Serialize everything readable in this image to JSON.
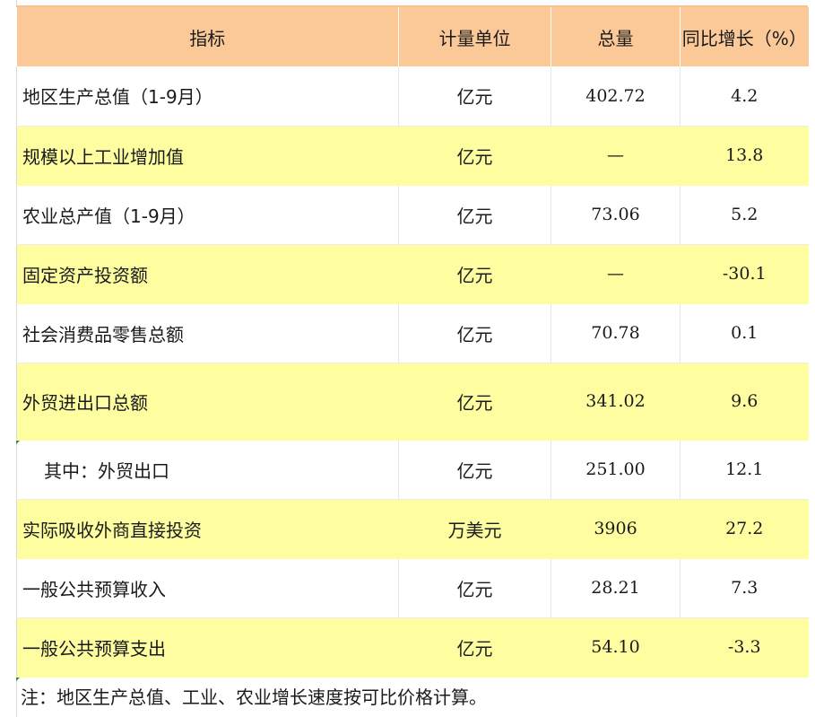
{
  "table": {
    "headers": [
      "指标",
      "计量单位",
      "总量",
      "同比增长（%）"
    ],
    "rows": [
      {
        "name": "地区生产总值（1-9月）",
        "unit": "亿元",
        "total": "402.72",
        "growth": "4.2",
        "highlight": false,
        "indent": false
      },
      {
        "name": "规模以上工业增加值",
        "unit": "亿元",
        "total": "—",
        "growth": "13.8",
        "highlight": true,
        "indent": false
      },
      {
        "name": "农业总产值（1-9月）",
        "unit": "亿元",
        "total": "73.06",
        "growth": "5.2",
        "highlight": false,
        "indent": false
      },
      {
        "name": "固定资产投资额",
        "unit": "亿元",
        "total": "—",
        "growth": "-30.1",
        "highlight": true,
        "indent": false
      },
      {
        "name": "社会消费品零售总额",
        "unit": "亿元",
        "total": "70.78",
        "growth": "0.1",
        "highlight": false,
        "indent": false
      },
      {
        "name": "外贸进出口总额",
        "unit": "亿元",
        "total": "341.02",
        "growth": "9.6",
        "highlight": true,
        "indent": false
      },
      {
        "name": "其中：外贸出口",
        "unit": "亿元",
        "total": "251.00",
        "growth": "12.1",
        "highlight": false,
        "indent": true
      },
      {
        "name": "实际吸收外商直接投资",
        "unit": "万美元",
        "total": "3906",
        "growth": "27.2",
        "highlight": true,
        "indent": false
      },
      {
        "name": "一般公共预算收入",
        "unit": "亿元",
        "total": "28.21",
        "growth": "7.3",
        "highlight": false,
        "indent": false
      },
      {
        "name": "一般公共预算支出",
        "unit": "亿元",
        "total": "54.10",
        "growth": "-3.3",
        "highlight": true,
        "indent": false
      }
    ]
  },
  "note": "注：地区生产总值、工业、农业增长速度按可比价格计算。",
  "colors": {
    "header_bg": "#fbc998",
    "highlight_bg": "#fefea0",
    "accent_line": "#f9c18f"
  }
}
